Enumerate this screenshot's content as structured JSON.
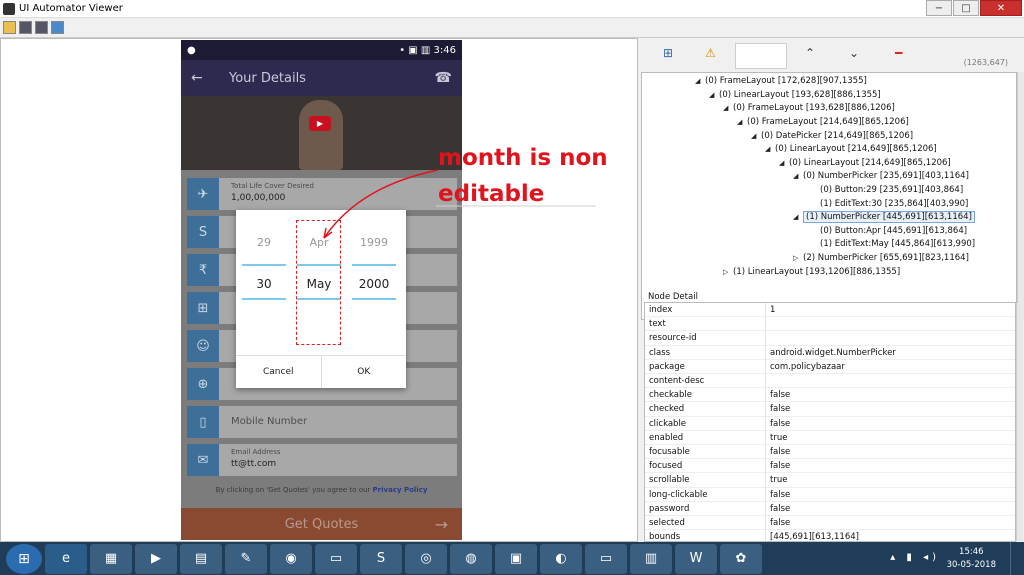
{
  "window": {
    "title": "UI Automator Viewer",
    "min": "−",
    "max": "□",
    "close": "✕"
  },
  "phone": {
    "status": {
      "left": "●",
      "right": "• ▣ ▥ 3:46"
    },
    "appbar": {
      "back": "←",
      "title": "Your Details",
      "phone": "☎"
    },
    "video_play": "▶",
    "rows": [
      {
        "icon": "✈",
        "label": "Total Life Cover Desired",
        "value": "1,00,00,000"
      },
      {
        "icon": "S",
        "label": "",
        "value": ""
      },
      {
        "icon": "₹",
        "label": "",
        "value": ""
      },
      {
        "icon": "⊞",
        "label": "",
        "value": ""
      },
      {
        "icon": "☺",
        "label": "",
        "value": ""
      },
      {
        "icon": "⊕",
        "label": "",
        "value": ""
      },
      {
        "icon": "▯",
        "placeholder": "Mobile Number"
      },
      {
        "icon": "✉",
        "label": "Email Address",
        "value": "tt@tt.com"
      }
    ],
    "consent": "By clicking on 'Get Quotes' you agree to our",
    "privacy": "Privacy Policy",
    "get_quotes": "Get Quotes",
    "arrow": "→"
  },
  "picker": {
    "day": {
      "prev": "29",
      "cur": "30"
    },
    "month": {
      "prev": "Apr",
      "cur": "May"
    },
    "year": {
      "prev": "1999",
      "cur": "2000"
    },
    "cancel": "Cancel",
    "ok": "OK"
  },
  "annotation": {
    "line1": "month is non",
    "line2": "editable"
  },
  "right_toolbar": {
    "coords": "(1263,647)"
  },
  "tree": [
    {
      "text": "(0) FrameLayout [172,628][907,1355]",
      "x": "",
      "depth": 0,
      "tri": "◢"
    },
    {
      "text": "(0) LinearLayout [193,628][886,1355]",
      "depth": 1,
      "tri": "◢"
    },
    {
      "text": "(0) FrameLayout [193,628][886,1206]",
      "depth": 2,
      "tri": "◢"
    },
    {
      "text": "(0) FrameLayout [214,649][865,1206]",
      "depth": 3,
      "tri": "◢"
    },
    {
      "text": "(0) DatePicker [214,649][865,1206]",
      "depth": 4,
      "tri": "◢"
    },
    {
      "text": "(0) LinearLayout [214,649][865,1206]",
      "depth": 5,
      "tri": "◢"
    },
    {
      "text": "(0) LinearLayout [214,649][865,1206]",
      "depth": 6,
      "tri": "◢"
    },
    {
      "text": "(0) NumberPicker [235,691][403,1164]",
      "depth": 7,
      "tri": "◢"
    },
    {
      "text": "(0) Button:29 [235,691][403,864]",
      "depth": 8,
      "tri": ""
    },
    {
      "text": "(1) EditText:30 [235,864][403,990]",
      "depth": 8,
      "tri": ""
    },
    {
      "text": "(1) NumberPicker [445,691][613,1164]",
      "depth": 7,
      "tri": "◢",
      "sel": true
    },
    {
      "text": "(0) Button:Apr [445,691][613,864]",
      "depth": 8,
      "tri": ""
    },
    {
      "text": "(1) EditText:May [445,864][613,990]",
      "depth": 8,
      "tri": ""
    },
    {
      "text": "(2) NumberPicker [655,691][823,1164]",
      "depth": 7,
      "tri": "▷"
    },
    {
      "text": "(1) LinearLayout [193,1206][886,1355]",
      "depth": 2,
      "tri": "▷"
    }
  ],
  "node_detail_title": "Node Detail",
  "details": [
    {
      "k": "index",
      "v": "1"
    },
    {
      "k": "text",
      "v": ""
    },
    {
      "k": "resource-id",
      "v": ""
    },
    {
      "k": "class",
      "v": "android.widget.NumberPicker"
    },
    {
      "k": "package",
      "v": "com.policybazaar"
    },
    {
      "k": "content-desc",
      "v": ""
    },
    {
      "k": "checkable",
      "v": "false"
    },
    {
      "k": "checked",
      "v": "false"
    },
    {
      "k": "clickable",
      "v": "false"
    },
    {
      "k": "enabled",
      "v": "true"
    },
    {
      "k": "focusable",
      "v": "false"
    },
    {
      "k": "focused",
      "v": "false"
    },
    {
      "k": "scrollable",
      "v": "true"
    },
    {
      "k": "long-clickable",
      "v": "false"
    },
    {
      "k": "password",
      "v": "false"
    },
    {
      "k": "selected",
      "v": "false"
    },
    {
      "k": "bounds",
      "v": "[445,691][613,1164]"
    }
  ],
  "taskbar": {
    "time": "15:46",
    "date": "30-05-2018"
  }
}
